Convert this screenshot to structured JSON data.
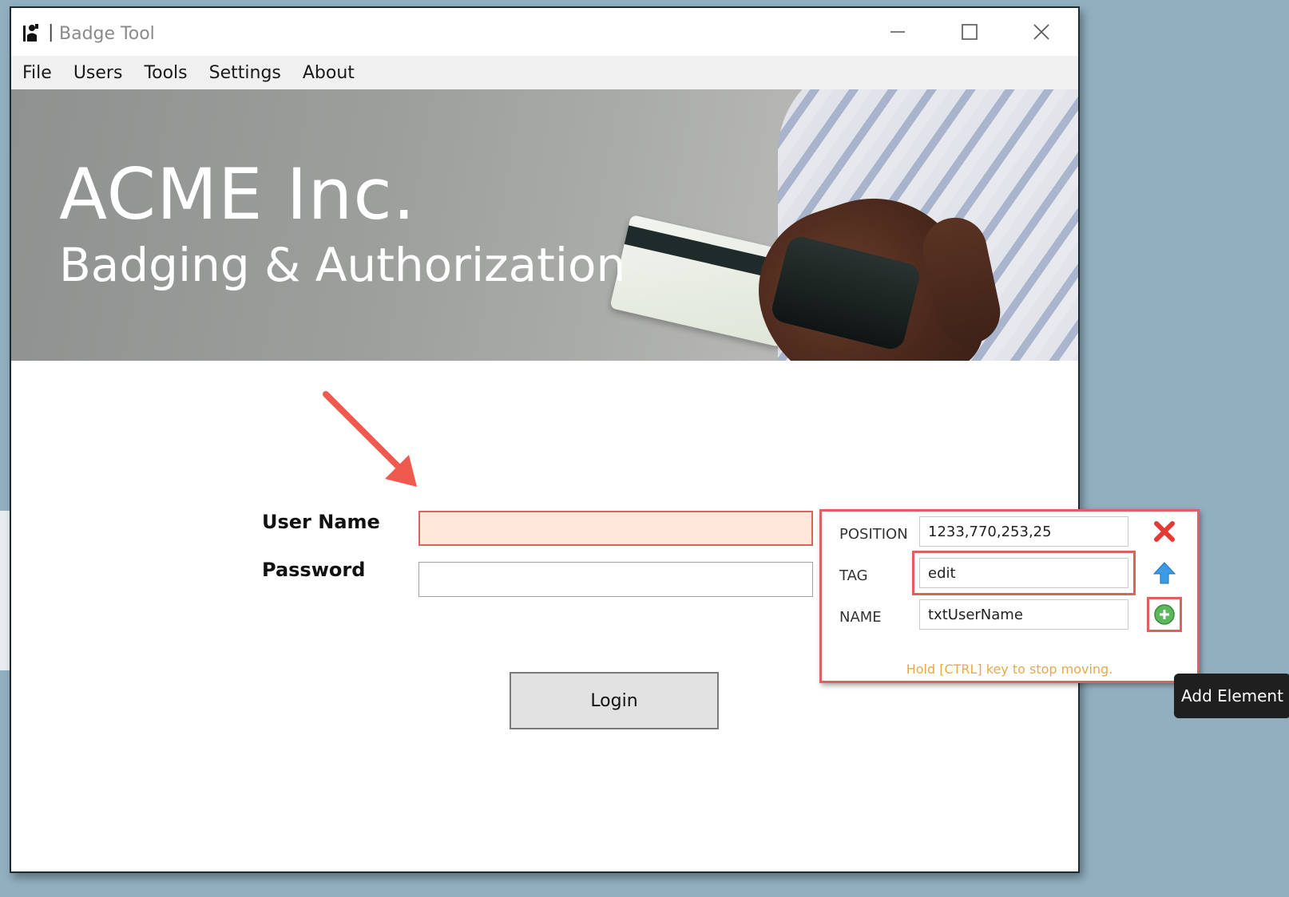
{
  "window": {
    "title": "Badge Tool",
    "separator": "|"
  },
  "menu": {
    "items": [
      {
        "label": "File"
      },
      {
        "label": "Users"
      },
      {
        "label": "Tools"
      },
      {
        "label": "Settings"
      },
      {
        "label": "About"
      }
    ]
  },
  "banner": {
    "title": "ACME Inc.",
    "subtitle": "Badging & Authorization"
  },
  "form": {
    "username_label": "User Name",
    "password_label": "Password",
    "username_value": "",
    "password_value": "",
    "login_label": "Login"
  },
  "inspector": {
    "position_label": "POSITION",
    "position_value": "1233,770,253,25",
    "tag_label": "TAG",
    "tag_value": "edit",
    "name_label": "NAME",
    "name_value": "txtUserName",
    "hint": "Hold [CTRL] key to stop moving."
  },
  "tooltip": {
    "text": "Add Element"
  },
  "colors": {
    "highlight": "#e0605e",
    "active_input": "#fde8da",
    "hint": "#e6a84a"
  }
}
